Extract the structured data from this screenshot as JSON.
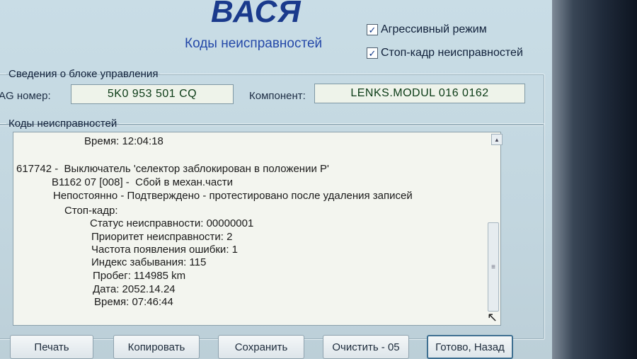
{
  "header": {
    "app_name": "ВАСЯ",
    "subtitle": "Коды неисправностей"
  },
  "options": {
    "aggressive_mode": {
      "label": "Агрессивный режим",
      "checked": true
    },
    "freeze_frame": {
      "label": "Стоп-кадр неисправностей",
      "checked": true
    }
  },
  "control_unit": {
    "legend": "Сведения о блоке управления",
    "vag_label": "AG номер:",
    "vag_number": "5K0 953 501 CQ",
    "component_label": "Компонент:",
    "component_value": "LENKS.MODUL  016 0162"
  },
  "fault_codes": {
    "legend": "Коды неисправностей",
    "lines": [
      "Время: 12:04:18",
      "617742 -  Выключатель 'селектор заблокирован в положении P'",
      "B1162 07 [008] -  Сбой в механ.части",
      "Непостоянно - Подтверждено - протестировано после удаления записей",
      "Стоп-кадр:",
      "Статус неисправности: 00000001",
      "Приоритет неисправности: 2",
      "Частота появления ошибки: 1",
      "Индекс забывания: 115",
      "Пробег: 114985 km",
      "Дата: 2052.14.24",
      "Время: 07:46:44"
    ]
  },
  "icons": {
    "check": "✓",
    "scroll_up": "▲",
    "thumb_grip": "≡",
    "cursor": "↖"
  },
  "buttons": {
    "print": "Печать",
    "copy": "Копировать",
    "save": "Сохранить",
    "clear": "Очистить - 05",
    "done": "Готово, Назад"
  }
}
